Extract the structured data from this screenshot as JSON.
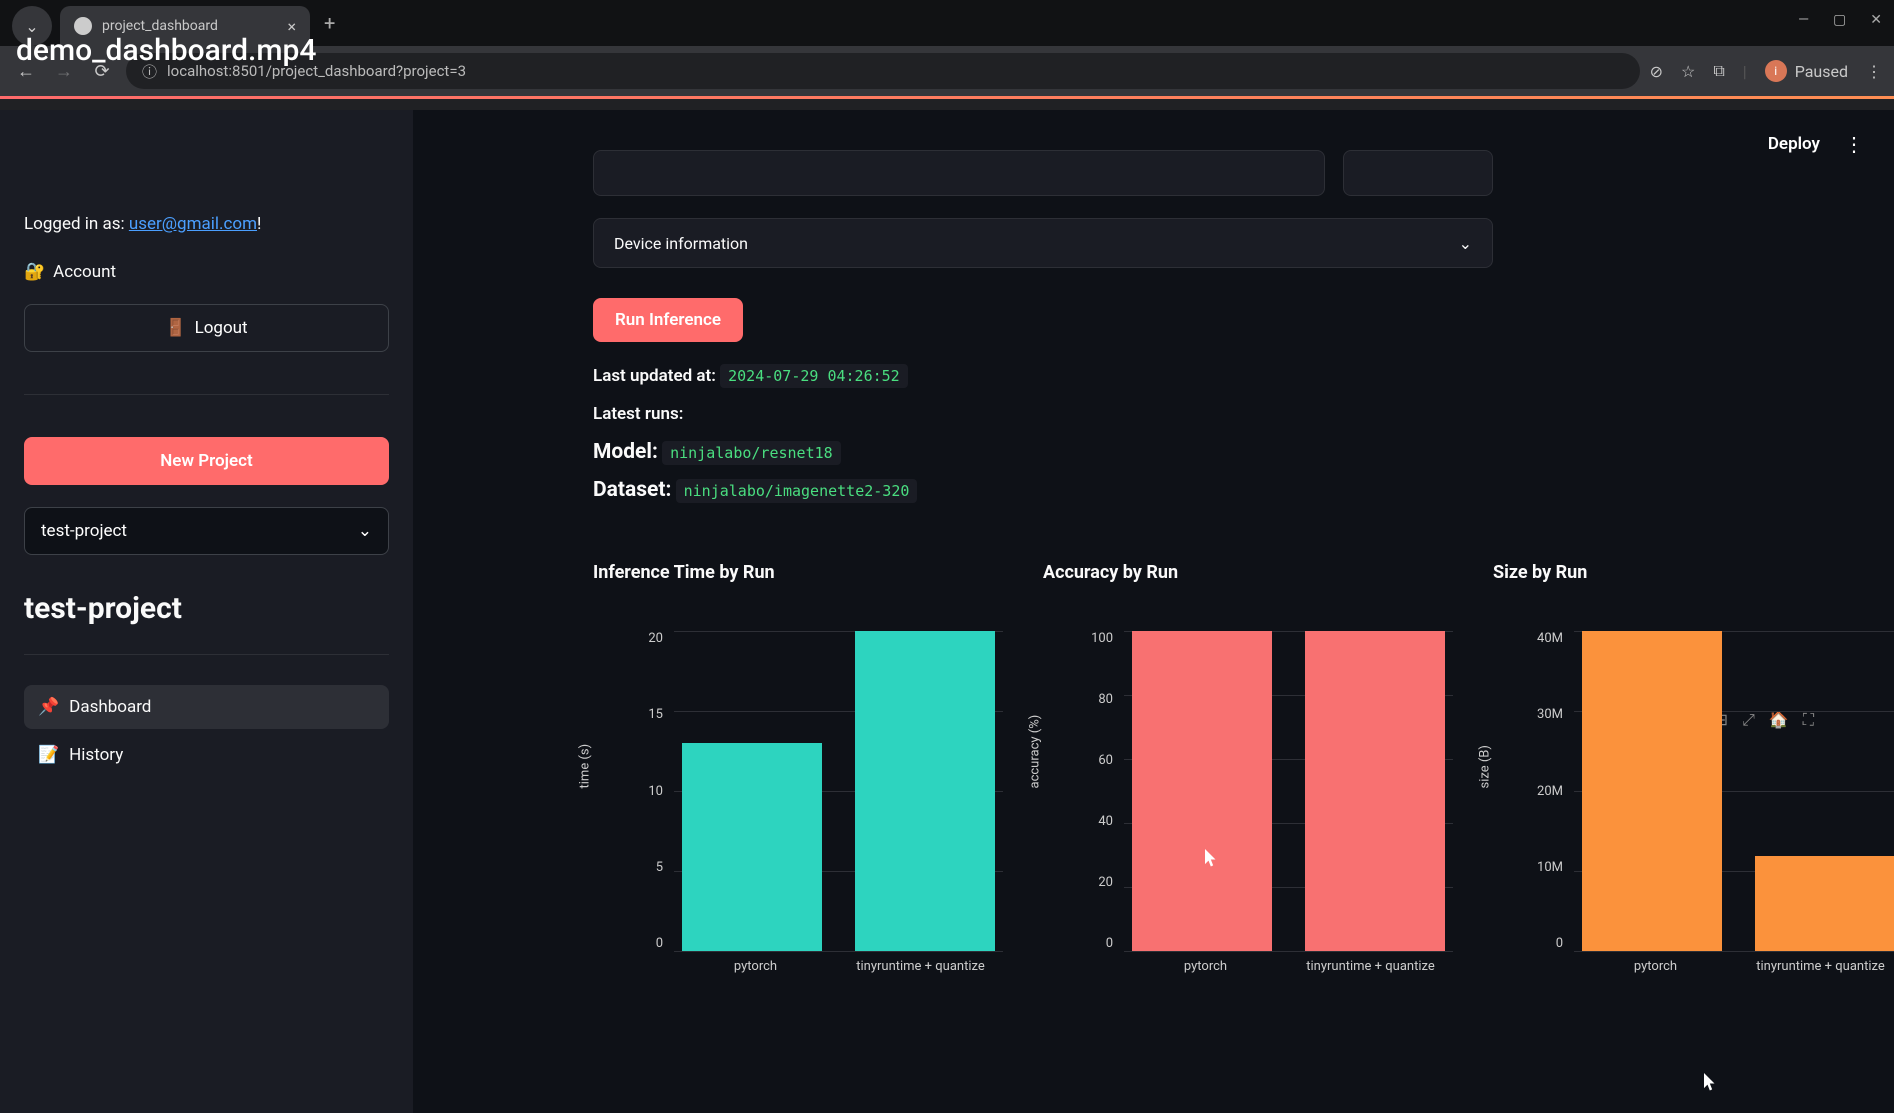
{
  "overlay_filename": "demo_dashboard.mp4",
  "browser": {
    "tab_title": "project_dashboard",
    "url": "localhost:8501/project_dashboard?project=3",
    "paused_label": "Paused"
  },
  "deploy_label": "Deploy",
  "sidebar": {
    "logged_in_prefix": "Logged in as: ",
    "user_email": "user@gmail.com",
    "logged_in_suffix": "!",
    "account_label": "Account",
    "logout_label": "Logout",
    "new_project_label": "New Project",
    "project_selected": "test-project",
    "project_title": "test-project",
    "nav": [
      {
        "icon": "📌",
        "label": "Dashboard",
        "active": true
      },
      {
        "icon": "📝",
        "label": "History",
        "active": false
      }
    ]
  },
  "main": {
    "expander_label": "Device information",
    "run_button": "Run Inference",
    "last_updated_label": "Last updated at:",
    "last_updated_value": "2024-07-29 04:26:52",
    "latest_runs_label": "Latest runs:",
    "model_label": "Model:",
    "model_value": "ninjalabo/resnet18",
    "dataset_label": "Dataset:",
    "dataset_value": "ninjalabo/imagenette2-320"
  },
  "chart_data": [
    {
      "type": "bar",
      "title": "Inference Time by Run",
      "ylabel": "time (s)",
      "ylim": [
        0,
        20
      ],
      "yticks": [
        20,
        15,
        10,
        5,
        0
      ],
      "categories": [
        "pytorch",
        "tinyruntime + quantize"
      ],
      "values": [
        13,
        20
      ],
      "color": "#2dd4bf"
    },
    {
      "type": "bar",
      "title": "Accuracy by Run",
      "ylabel": "accuracy (%)",
      "ylim": [
        0,
        100
      ],
      "yticks": [
        100,
        80,
        60,
        40,
        20,
        0
      ],
      "categories": [
        "pytorch",
        "tinyruntime + quantize"
      ],
      "values": [
        100,
        100
      ],
      "color": "#f87171"
    },
    {
      "type": "bar",
      "title": "Size by Run",
      "ylabel": "size (B)",
      "ylim": [
        0,
        44000000
      ],
      "yticks": [
        "40M",
        "30M",
        "20M",
        "10M",
        "0"
      ],
      "ytick_values": [
        40000000,
        30000000,
        20000000,
        10000000,
        0
      ],
      "categories": [
        "pytorch",
        "tinyruntime + quantize"
      ],
      "values": [
        44000000,
        13000000
      ],
      "color": "#fb923c"
    }
  ]
}
